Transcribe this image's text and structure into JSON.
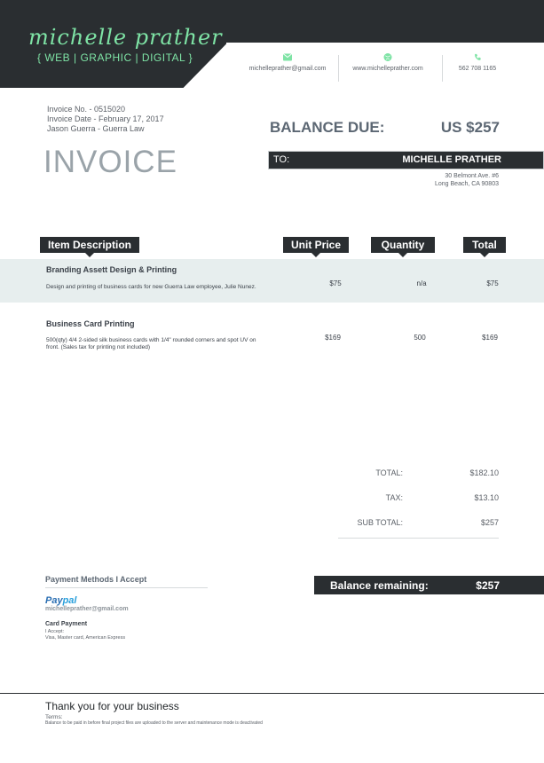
{
  "brand": {
    "name": "michelle prather",
    "tagline": "{ WEB | GRAPHIC | DIGITAL }",
    "accent_color": "#7ee3a5",
    "dark_color": "#2a2e31"
  },
  "contacts": [
    {
      "icon": "envelope-icon",
      "text": "michelleprather@gmail.com"
    },
    {
      "icon": "globe-icon",
      "text": "www.michelleprather.com"
    },
    {
      "icon": "phone-icon",
      "text": "562 708 1165"
    }
  ],
  "invoice": {
    "number": "Invoice No. - 0515020",
    "date": "Invoice Date - February 17, 2017",
    "client_line": "Jason Guerra - Guerra Law",
    "title": "INVOICE"
  },
  "balance": {
    "label": "BALANCE DUE:",
    "amount": "US $257"
  },
  "to": {
    "label": "TO:",
    "name": "MICHELLE PRATHER",
    "address1": "30 Belmont Ave. #6",
    "address2": "Long Beach, CA 90803"
  },
  "columns": {
    "description": "Item Description",
    "unit_price": "Unit Price",
    "quantity": "Quantity",
    "total": "Total"
  },
  "items": [
    {
      "title": "Branding Assett Design & Printing",
      "description": "Design and printing of business cards for new Guerra Law employee, Julie Nunez.",
      "unit_price": "$75",
      "quantity": "n/a",
      "total": "$75"
    },
    {
      "title": "Business Card Printing",
      "description": "500(qty) 4/4 2-sided silk business cards with 1/4\" rounded corners and spot UV on front.  (Sales tax for printing not included)",
      "unit_price": "$169",
      "quantity": "500",
      "total": "$169"
    }
  ],
  "totals": [
    {
      "label": "TOTAL:",
      "value": "$182.10"
    },
    {
      "label": "TAX:",
      "value": "$13.10"
    },
    {
      "label": "SUB TOTAL:",
      "value": "$257"
    }
  ],
  "payment": {
    "title": "Payment Methods I Accept",
    "paypal_pay": "Pay",
    "paypal_pal": "pal",
    "email": "michelleprather@gmail.com",
    "card_title": "Card Payment",
    "card_accept": "I Accept:",
    "card_types": "Visa, Master card, American Express"
  },
  "remaining": {
    "label": "Balance remaining:",
    "amount": "$257"
  },
  "footer": {
    "thanks": "Thank you for your business",
    "terms_title": "Terms:",
    "terms_text": "Balance to be paid in before final project files are uploaded to the server and maintenance mode is deactivated"
  }
}
